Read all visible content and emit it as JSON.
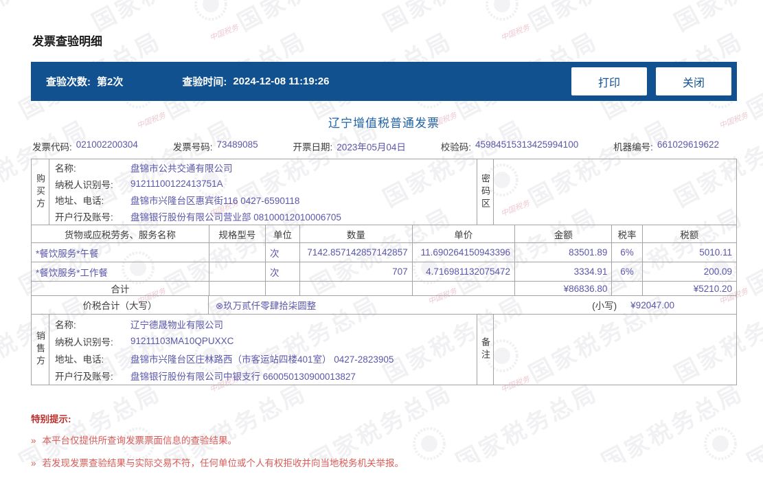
{
  "page": {
    "title": "发票查验明细"
  },
  "toolbar": {
    "check_count_label": "查验次数:",
    "check_count_value": "第2次",
    "check_time_label": "查验时间:",
    "check_time_value": "2024-12-08 11:19:26",
    "print_label": "打印",
    "close_label": "关闭"
  },
  "invoice": {
    "title": "辽宁增值税普通发票",
    "meta": {
      "code_label": "发票代码:",
      "code": "021002200304",
      "number_label": "发票号码:",
      "number": "73489085",
      "date_label": "开票日期:",
      "date": "2023年05月04日",
      "checksum_label": "校验码:",
      "checksum": "45984515313425994100",
      "machine_label": "机器编号:",
      "machine": "661029619622"
    },
    "buyer": {
      "side_label": "购买方",
      "rows": [
        {
          "label": "名称:",
          "value": "盘锦市公共交通有限公司"
        },
        {
          "label": "纳税人识别号:",
          "value": "91211100122413751A"
        },
        {
          "label": "地址、电话:",
          "value": "盘锦市兴隆台区惠宾街116 0427-6590118"
        },
        {
          "label": "开户行及账号:",
          "value": "盘锦银行股份有限公司营业部 08100012010006705"
        }
      ],
      "password_label": "密码区"
    },
    "items": {
      "headers": [
        "货物或应税劳务、服务名称",
        "规格型号",
        "单位",
        "数量",
        "单价",
        "金额",
        "税率",
        "税额"
      ],
      "rows": [
        {
          "name": "*餐饮服务*午餐",
          "spec": "",
          "unit": "次",
          "qty": "7142.857142857142857",
          "price": "11.690264150943396",
          "amount": "83501.89",
          "rate": "6%",
          "tax": "5010.11"
        },
        {
          "name": "*餐饮服务*工作餐",
          "spec": "",
          "unit": "次",
          "qty": "707",
          "price": "4.716981132075472",
          "amount": "3334.91",
          "rate": "6%",
          "tax": "200.09"
        }
      ],
      "total_label": "合计",
      "total_amount": "¥86836.80",
      "total_tax": "¥5210.20"
    },
    "summary": {
      "label": "价税合计（大写）",
      "words": "⊗玖万贰仟零肆拾柒圆整",
      "small_label": "(小写)",
      "small_value": "¥92047.00"
    },
    "seller": {
      "side_label": "销售方",
      "rows": [
        {
          "label": "名称:",
          "value": "辽宁德晟物业有限公司"
        },
        {
          "label": "纳税人识别号:",
          "value": "91211103MA10QPUXXC"
        },
        {
          "label": "地址、电话:",
          "value": "盘锦市兴隆台区庄林路西（市客运站四楼401室） 0427-2823905"
        },
        {
          "label": "开户行及账号:",
          "value": "盘锦银行股份有限公司中银支行 660050130900013827"
        }
      ],
      "note_label": "备注"
    }
  },
  "notices": {
    "title": "特别提示:",
    "marker": "»",
    "items": [
      "本平台仅提供所查询发票票面信息的查验结果。",
      "若发现发票查验结果与实际交易不符，任何单位或个人有权拒收并向当地税务机关举报。"
    ]
  },
  "watermark": {
    "text": "国家税务总局",
    "stamp_text": "中国税务"
  },
  "colors": {
    "bar_blue": "#11518f",
    "title_blue": "#1e63a8",
    "value_indigo": "#5a57ab",
    "label_gray": "#3c3c3c",
    "border_gray": "#a3a3a3",
    "notice_strong": "#bb2f2e",
    "notice_red": "#d85c58"
  }
}
